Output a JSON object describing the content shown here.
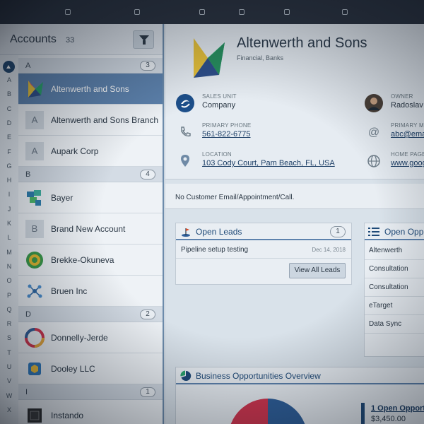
{
  "toolbar": {
    "items": [
      "",
      "",
      "",
      "",
      "",
      ""
    ]
  },
  "accounts": {
    "title": "Accounts",
    "count": "33",
    "letters": [
      "A",
      "B",
      "C",
      "D",
      "E",
      "F",
      "G",
      "H",
      "I",
      "J",
      "K",
      "L",
      "M",
      "N",
      "O",
      "P",
      "Q",
      "R",
      "S",
      "T",
      "U",
      "V",
      "W",
      "X"
    ],
    "active_letter": "#",
    "sections": {
      "a": {
        "label": "A",
        "count": "3"
      },
      "b": {
        "label": "B",
        "count": "4"
      },
      "d": {
        "label": "D",
        "count": "2"
      },
      "i": {
        "label": "I",
        "count": "1"
      }
    },
    "rows": {
      "altenwerth": {
        "name": "Altenwerth and Sons",
        "selected": true
      },
      "altenwerth_branch": {
        "name": "Altenwerth and Sons Branch",
        "initial": "A"
      },
      "aupark": {
        "name": "Aupark Corp",
        "initial": "A"
      },
      "bayer": {
        "name": "Bayer"
      },
      "brand_new": {
        "name": "Brand New Account",
        "initial": "B"
      },
      "brekke": {
        "name": "Brekke-Okuneva"
      },
      "bruen": {
        "name": "Bruen Inc"
      },
      "donnelly": {
        "name": "Donnelly-Jerde"
      },
      "dooley": {
        "name": "Dooley LLC"
      },
      "instando": {
        "name": "Instando"
      }
    }
  },
  "detail": {
    "name": "Altenwerth and Sons",
    "industry": "Financial, Banks",
    "sales_unit": {
      "label": "SALES UNIT",
      "value": "Company"
    },
    "phone": {
      "label": "PRIMARY PHONE",
      "value": "561-822-6775"
    },
    "location": {
      "label": "LOCATION",
      "value": "103 Cody Court, Pam Beach, FL, USA"
    },
    "owner": {
      "label": "OWNER",
      "value": "Radoslav"
    },
    "primary_mail": {
      "label": "PRIMARY M",
      "value": "abc@ema"
    },
    "home_page": {
      "label": "HOME PAGE",
      "value": "www.goog"
    },
    "message": "No Customer Email/Appointment/Call.",
    "open_leads": {
      "title": "Open Leads",
      "count": "1",
      "items": [
        {
          "name": "Pipeline setup testing",
          "date": "Dec 14, 2018"
        }
      ],
      "view_all": "View All Leads"
    },
    "open_opps": {
      "title": "Open Oppo",
      "items": [
        "Altenwerth",
        "Consultation",
        "Consultation",
        "eTarget",
        "Data Sync"
      ]
    },
    "overview": {
      "title": "Business Opportunities Overview",
      "legend_label": "1 Open Opport",
      "legend_value": "$3,450.00",
      "colors": {
        "red": "#d2354e",
        "blue": "#2e5f9a"
      }
    }
  }
}
